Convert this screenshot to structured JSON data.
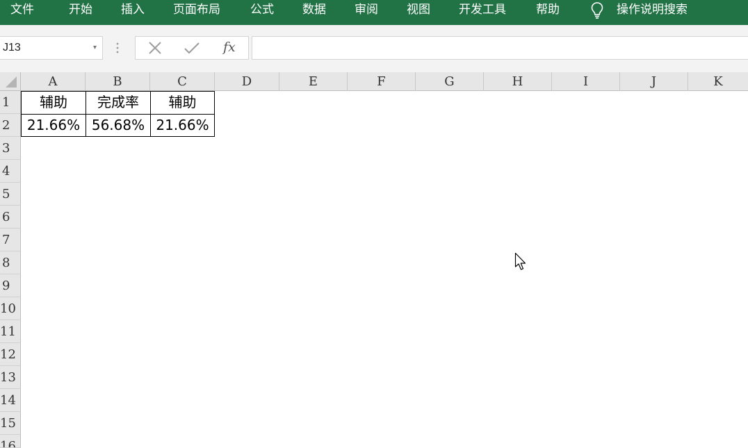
{
  "ribbon": {
    "tabs": [
      "文件",
      "开始",
      "插入",
      "页面布局",
      "公式",
      "数据",
      "审阅",
      "视图",
      "开发工具",
      "帮助"
    ],
    "tell_me": "操作说明搜索",
    "tell_me_icon": "lightbulb-icon",
    "color": "#217346"
  },
  "formula_bar": {
    "name_box": "J13",
    "name_box_caret": "▾",
    "fx": "fx",
    "formula": ""
  },
  "grid": {
    "columns": [
      "A",
      "B",
      "C",
      "D",
      "E",
      "F",
      "G",
      "H",
      "I",
      "J",
      "K"
    ],
    "rows": [
      "1",
      "2",
      "3",
      "4",
      "5",
      "6",
      "7",
      "8",
      "9",
      "10",
      "11",
      "12",
      "13",
      "14",
      "15",
      "16"
    ],
    "cells": {
      "A1": "辅助",
      "B1": "完成率",
      "C1": "辅助",
      "A2": "21.66%",
      "B2": "56.68%",
      "C2": "21.66%"
    }
  }
}
